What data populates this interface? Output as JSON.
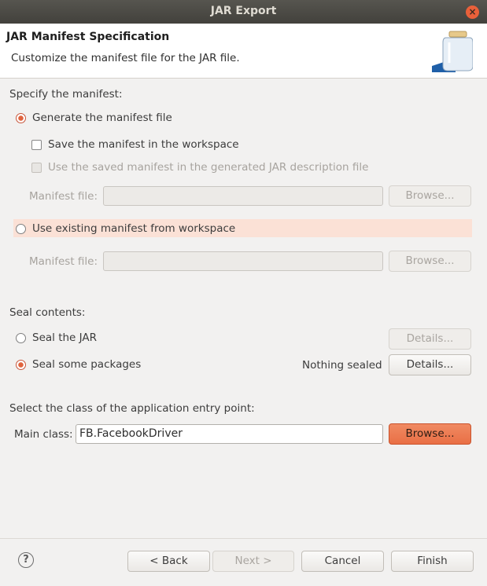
{
  "window": {
    "title": "JAR Export",
    "close_icon": "×"
  },
  "header": {
    "title": "JAR Manifest Specification",
    "subtitle": "Customize the manifest file for the JAR file."
  },
  "manifest_section": {
    "label": "Specify the manifest:",
    "generate_label": "Generate the manifest file",
    "save_label": "Save the manifest in the workspace",
    "use_saved_label": "Use the saved manifest in the generated JAR description file",
    "manifest_file_label": "Manifest file:",
    "browse_label": "Browse...",
    "use_existing_label": "Use existing manifest from workspace",
    "manifest_file_label2": "Manifest file:",
    "browse_label2": "Browse..."
  },
  "seal_section": {
    "label": "Seal contents:",
    "seal_jar_label": "Seal the JAR",
    "details_label": "Details...",
    "seal_some_label": "Seal some packages",
    "nothing_sealed": "Nothing sealed",
    "details_label2": "Details..."
  },
  "entry_section": {
    "label": "Select the class of the application entry point:",
    "main_class_label": "Main class:",
    "main_class_value": "FB.FacebookDriver",
    "browse_label": "Browse..."
  },
  "footer": {
    "help_icon": "?",
    "back_label": "< Back",
    "next_label": "Next >",
    "cancel_label": "Cancel",
    "finish_label": "Finish"
  },
  "colors": {
    "accent": "#e96f45",
    "highlight": "#fbe1d6",
    "titlebar": "#4a4944"
  }
}
